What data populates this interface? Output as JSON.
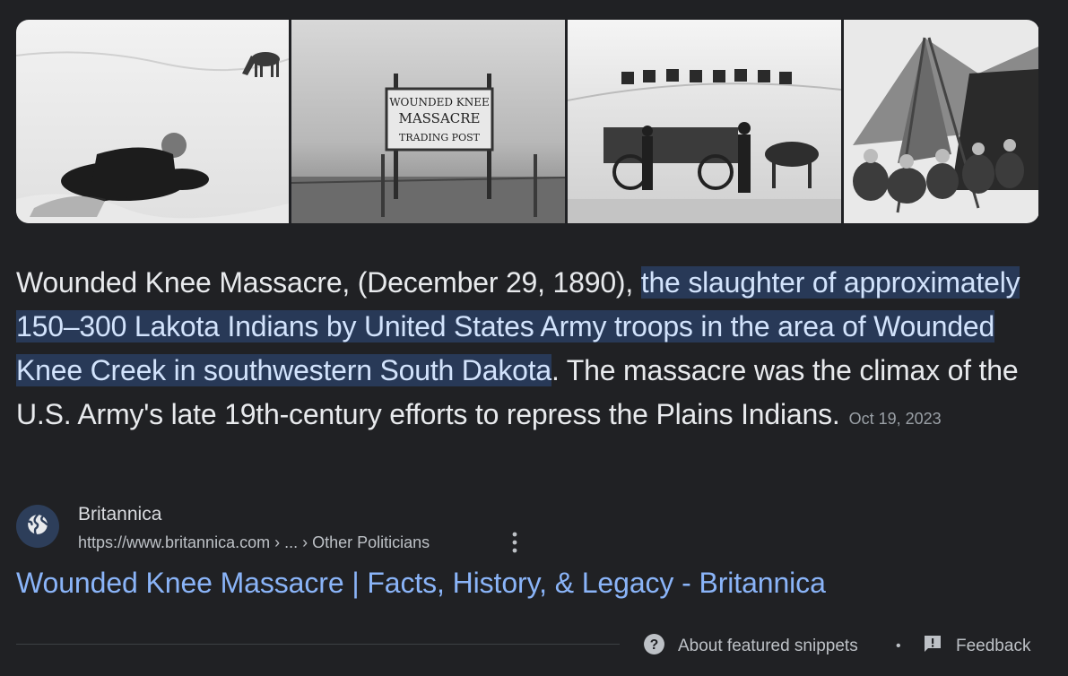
{
  "images": [
    {
      "name": "wounded-knee-photo-1"
    },
    {
      "name": "wounded-knee-trading-post-sign"
    },
    {
      "name": "wounded-knee-troops-wagon"
    },
    {
      "name": "wounded-knee-tent-gathering"
    }
  ],
  "sign_text": [
    "WOUNDED KNEE",
    "MASSACRE",
    "TRADING POST"
  ],
  "snippet": {
    "lead": "Wounded Knee Massacre, (December 29, 1890), ",
    "highlight": "the slaughter of approximately 150–300 Lakota Indians by United States Army troops in the area of Wounded Knee Creek in southwestern South Dakota",
    "rest": ". The massacre was the climax of the U.S. Army's late 19th-century efforts to repress the Plains Indians.",
    "date": "Oct 19, 2023"
  },
  "source": {
    "icon": "globe-icon",
    "name": "Britannica",
    "url": "https://www.britannica.com › ... › Other Politicians",
    "more_icon": "more-vert-icon"
  },
  "result": {
    "title": "Wounded Knee Massacre | Facts, History, & Legacy - Britannica"
  },
  "footer": {
    "about_icon": "help-circle-icon",
    "about_label": "About featured snippets",
    "separator": "•",
    "feedback_icon": "feedback-icon",
    "feedback_label": "Feedback"
  },
  "colors": {
    "background": "#202124",
    "text": "#e8eaed",
    "highlight_bg": "#283957",
    "link": "#8ab4f8",
    "muted": "#9aa0a6"
  }
}
